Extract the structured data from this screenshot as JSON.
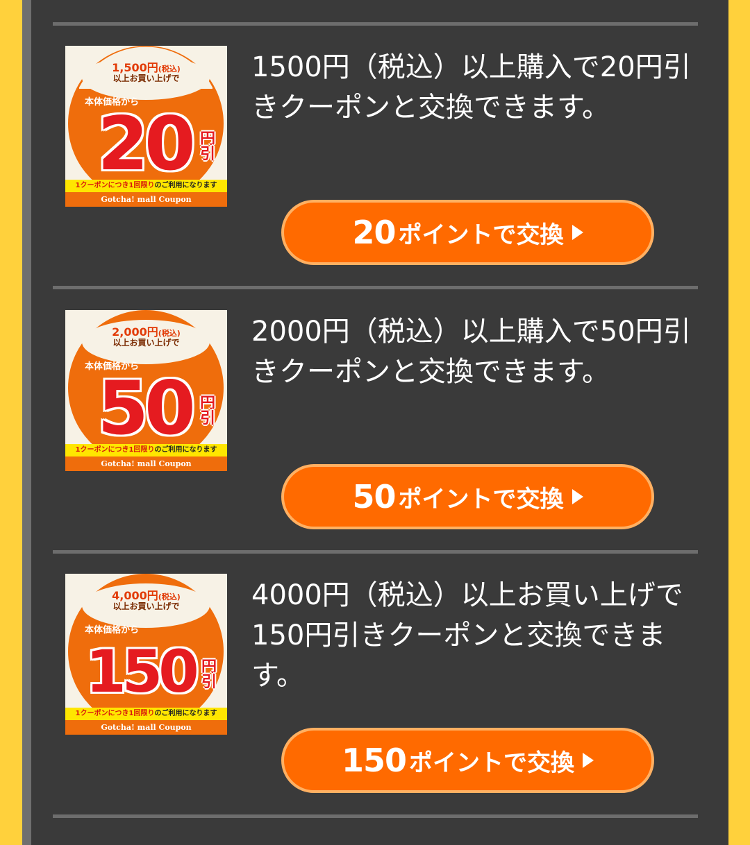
{
  "items": [
    {
      "coupon": {
        "condition_amount": "1,500円",
        "tax_note": "(税込)",
        "condition_text": "以上お買い上げで",
        "base_text": "本体価格から",
        "discount_value": "20",
        "yen_text": "円引",
        "limit_text": "1クーポンにつき1回限り",
        "limit_suffix": "のご利用になります",
        "brand_text": "Gotcha! mall Coupon"
      },
      "description": "1500円（税込）以上購入で20円引きクーポンと交換できます。",
      "button": {
        "points": "20",
        "label": "ポイントで交換"
      }
    },
    {
      "coupon": {
        "condition_amount": "2,000円",
        "tax_note": "(税込)",
        "condition_text": "以上お買い上げで",
        "base_text": "本体価格から",
        "discount_value": "50",
        "yen_text": "円引",
        "limit_text": "1クーポンにつき1回限り",
        "limit_suffix": "のご利用になります",
        "brand_text": "Gotcha! mall Coupon"
      },
      "description": "2000円（税込）以上購入で50円引きクーポンと交換できます。",
      "button": {
        "points": "50",
        "label": "ポイントで交換"
      }
    },
    {
      "coupon": {
        "condition_amount": "4,000円",
        "tax_note": "(税込)",
        "condition_text": "以上お買い上げで",
        "base_text": "本体価格から",
        "discount_value": "150",
        "yen_text": "円引",
        "limit_text": "1クーポンにつき1回限り",
        "limit_suffix": "のご利用になります",
        "brand_text": "Gotcha! mall Coupon"
      },
      "description": "4000円（税込）以上お買い上げで150円引きクーポンと交換できます。",
      "button": {
        "points": "150",
        "label": "ポイントで交換"
      }
    }
  ],
  "colors": {
    "background_outer": "#ffd13c",
    "panel": "#3a3a3a",
    "button": "#ff6a00",
    "button_border": "#ffb062",
    "coupon_orange": "#ef6d0c",
    "coupon_red": "#e51b20"
  },
  "icons": {
    "button_arrow": "triangle-right-icon"
  }
}
